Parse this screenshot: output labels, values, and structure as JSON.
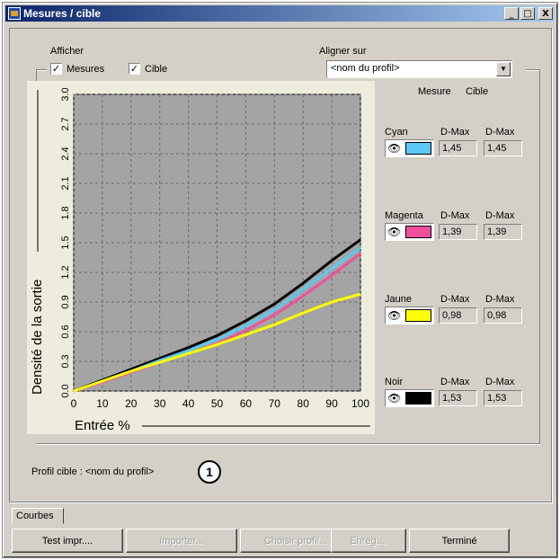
{
  "window": {
    "title": "Mesures / cible",
    "minimize": "_",
    "maximize": "□",
    "close": "X"
  },
  "display": {
    "label": "Afficher",
    "mesures": {
      "label": "Mesures",
      "checked": true
    },
    "cible": {
      "label": "Cible",
      "checked": true
    }
  },
  "align": {
    "label": "Aligner sur",
    "value": "<nom du profil>"
  },
  "columns": {
    "mesure": "Mesure",
    "cible": "Cible"
  },
  "channels": [
    {
      "name": "Cyan",
      "dmax_label_1": "D-Max",
      "dmax_label_2": "D-Max",
      "mesure": "1,45",
      "cible": "1,45",
      "color": "#5bc8f5"
    },
    {
      "name": "Magenta",
      "dmax_label_1": "D-Max",
      "dmax_label_2": "D-Max",
      "mesure": "1,39",
      "cible": "1,39",
      "color": "#f0509a"
    },
    {
      "name": "Jaune",
      "dmax_label_1": "D-Max",
      "dmax_label_2": "D-Max",
      "mesure": "0,98",
      "cible": "0,98",
      "color": "#ffff00"
    },
    {
      "name": "Noir",
      "dmax_label_1": "D-Max",
      "dmax_label_2": "D-Max",
      "mesure": "1,53",
      "cible": "1,53",
      "color": "#000000"
    }
  ],
  "profile_text": "Profil cible : <nom du profil>",
  "callout": "1",
  "tab": "Courbes",
  "buttons": {
    "test": "Test impr....",
    "import": "Importer...",
    "choose": "Choisir profil...",
    "save": "Enreg....",
    "done": "Terminé"
  },
  "chart_data": {
    "type": "line",
    "xlabel": "Entrée %",
    "ylabel": "Densité de la sortie",
    "xlim": [
      0,
      100
    ],
    "ylim": [
      0,
      3.0
    ],
    "xticks": [
      "0",
      "10",
      "20",
      "30",
      "40",
      "50",
      "60",
      "70",
      "80",
      "90",
      "100"
    ],
    "yticks": [
      "0.0",
      "0.3",
      "0.6",
      "0.9",
      "1.2",
      "1.5",
      "1.8",
      "2.1",
      "2.4",
      "2.7",
      "3.0"
    ],
    "grid": true,
    "x": [
      0,
      10,
      20,
      30,
      40,
      50,
      60,
      70,
      80,
      90,
      100
    ],
    "series": [
      {
        "name": "Noir",
        "color": "#000000",
        "values": [
          0,
          0.11,
          0.22,
          0.33,
          0.44,
          0.56,
          0.71,
          0.88,
          1.09,
          1.32,
          1.53
        ]
      },
      {
        "name": "Cyan",
        "color": "#5bc8f5",
        "values": [
          0,
          0.1,
          0.2,
          0.31,
          0.41,
          0.52,
          0.66,
          0.82,
          1.03,
          1.24,
          1.45
        ]
      },
      {
        "name": "Magenta",
        "color": "#f0509a",
        "values": [
          0,
          0.09,
          0.19,
          0.29,
          0.38,
          0.48,
          0.61,
          0.77,
          0.96,
          1.17,
          1.39
        ]
      },
      {
        "name": "Jaune",
        "color": "#ffff00",
        "values": [
          0,
          0.1,
          0.2,
          0.29,
          0.38,
          0.47,
          0.57,
          0.67,
          0.79,
          0.9,
          0.98
        ]
      }
    ]
  }
}
